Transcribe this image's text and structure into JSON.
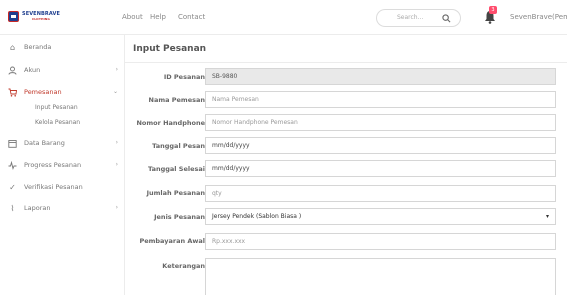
{
  "brand": {
    "name": "SEVENBRAVE",
    "sub": "CLOTHING"
  },
  "topnav": {
    "about": "About",
    "help": "Help",
    "contact": "Contact"
  },
  "search": {
    "placeholder": "Search..."
  },
  "notifications": {
    "count": "3"
  },
  "user": {
    "name": "SevenBrave(Pemilik)"
  },
  "sidebar": {
    "items": [
      {
        "label": "Beranda",
        "icon": "home-icon"
      },
      {
        "label": "Akun",
        "icon": "user-icon"
      },
      {
        "label": "Pemesanan",
        "icon": "cart-icon"
      },
      {
        "label": "Data Barang",
        "icon": "calendar-icon"
      },
      {
        "label": "Progress Pesanan",
        "icon": "pulse-icon"
      },
      {
        "label": "Verifikasi Pesanan",
        "icon": "check-icon"
      },
      {
        "label": "Laporan",
        "icon": "report-icon"
      }
    ],
    "sub_items": [
      "Input Pesanan",
      "Kelola Pesanan"
    ]
  },
  "page": {
    "title": "Input Pesanan"
  },
  "form": {
    "id_label": "ID Pesanan",
    "id_value": "SB-9880",
    "nama_label": "Nama Pemesan",
    "nama_placeholder": "Nama Pemesan",
    "hp_label": "Nomor Handphone",
    "hp_placeholder": "Nomor Handphone Pemesan",
    "tgl_pesan_label": "Tanggal Pesan",
    "tgl_pesan_placeholder": "mm/dd/yyyy",
    "tgl_selesai_label": "Tanggal Selesai",
    "tgl_selesai_placeholder": "mm/dd/yyyy",
    "jumlah_label": "Jumlah Pesanan",
    "jumlah_placeholder": "qty",
    "jenis_label": "Jenis Pesanan",
    "jenis_value": "Jersey Pendek (Sablon Biasa )",
    "bayar_label": "Pembayaran Awal",
    "bayar_placeholder": "Rp.xxx.xxx",
    "ket_label": "Keterangan",
    "ket_placeholder": ""
  }
}
